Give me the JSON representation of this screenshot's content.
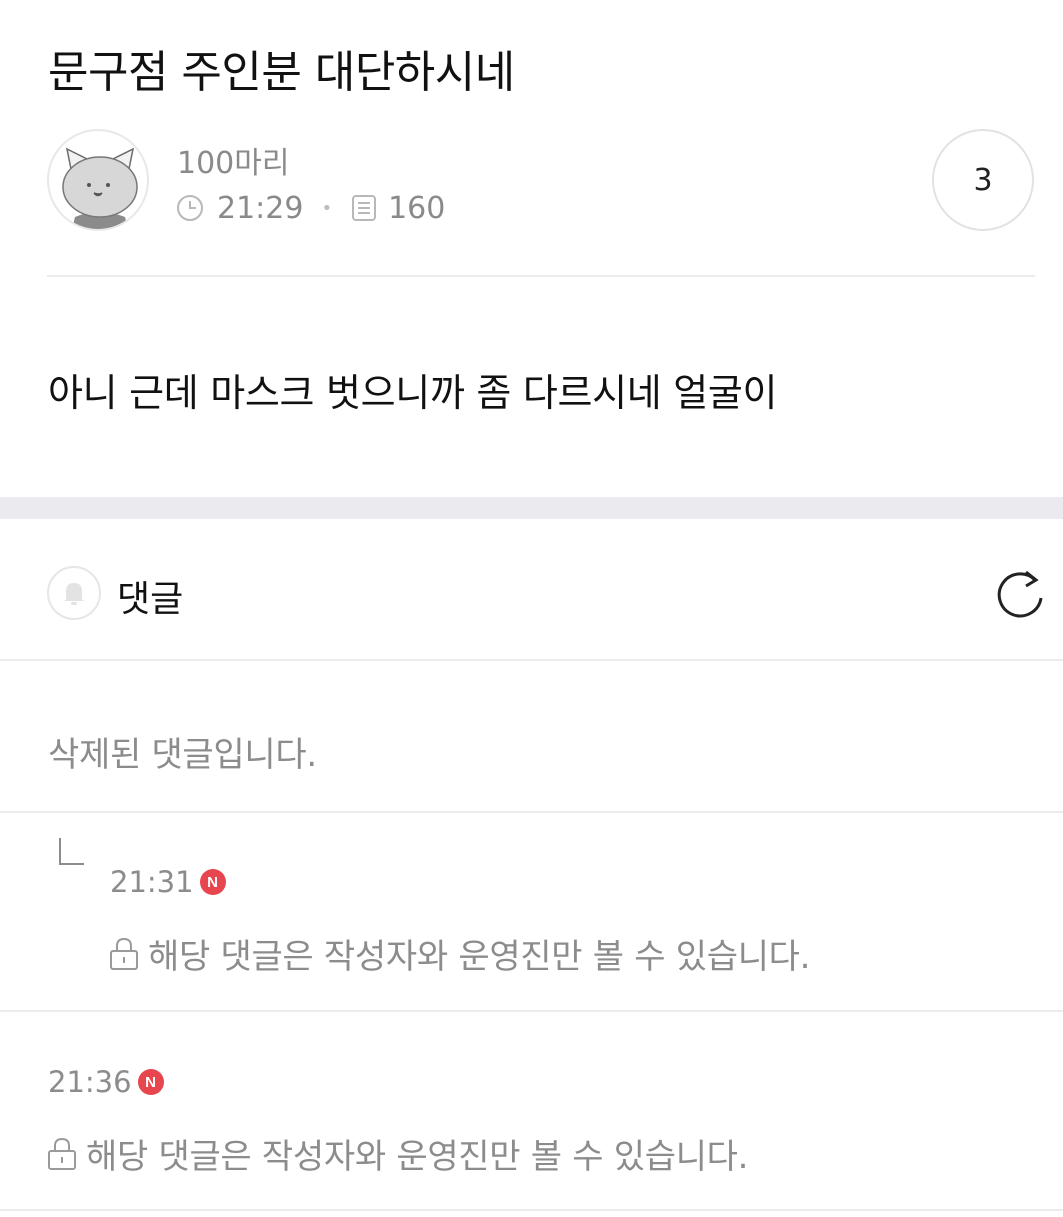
{
  "post": {
    "title": "문구점 주인분 대단하시네",
    "author": "100마리",
    "time": "21:29",
    "views": "160",
    "comment_count": "3",
    "body": "아니 근데 마스크 벗으니까 좀 다르시네 얼굴이"
  },
  "comments_section": {
    "label": "댓글",
    "icons": {
      "bell": "bell-icon",
      "refresh": "refresh-icon"
    }
  },
  "comments": [
    {
      "deleted_text": "삭제된 댓글입니다."
    },
    {
      "time": "21:31",
      "badge": "N",
      "text": "해당 댓글은 작성자와 운영진만 볼 수 있습니다.",
      "is_reply": true
    },
    {
      "time": "21:36",
      "badge": "N",
      "text": "해당 댓글은 작성자와 운영진만 볼 수 있습니다.",
      "is_reply": false
    }
  ],
  "colors": {
    "new_badge": "#e8464e",
    "muted_text": "#8c8c8c"
  }
}
